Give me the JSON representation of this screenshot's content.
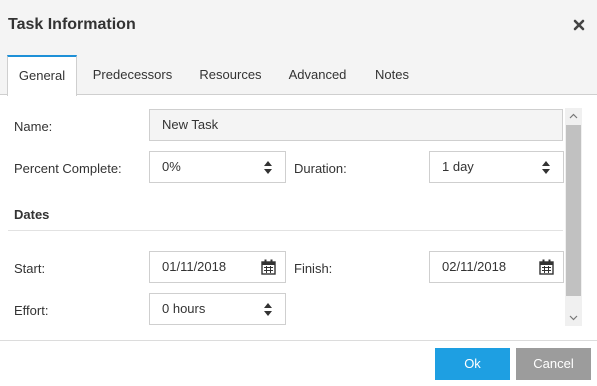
{
  "dialog": {
    "title": "Task Information",
    "close_icon": "close-icon"
  },
  "tabs": [
    {
      "label": "General",
      "active": true
    },
    {
      "label": "Predecessors",
      "active": false
    },
    {
      "label": "Resources",
      "active": false
    },
    {
      "label": "Advanced",
      "active": false
    },
    {
      "label": "Notes",
      "active": false
    }
  ],
  "form": {
    "name": {
      "label": "Name:",
      "value": "New Task"
    },
    "percent_complete": {
      "label": "Percent Complete:",
      "value": "0%"
    },
    "duration": {
      "label": "Duration:",
      "value": "1 day"
    },
    "dates_section": "Dates",
    "start": {
      "label": "Start:",
      "value": "01/11/2018"
    },
    "finish": {
      "label": "Finish:",
      "value": "02/11/2018"
    },
    "effort": {
      "label": "Effort:",
      "value": "0 hours"
    }
  },
  "buttons": {
    "ok": "Ok",
    "cancel": "Cancel"
  },
  "colors": {
    "accent": "#1e9fe2",
    "cancel": "#9c9c9c",
    "header_bg": "#f4f4f4"
  }
}
